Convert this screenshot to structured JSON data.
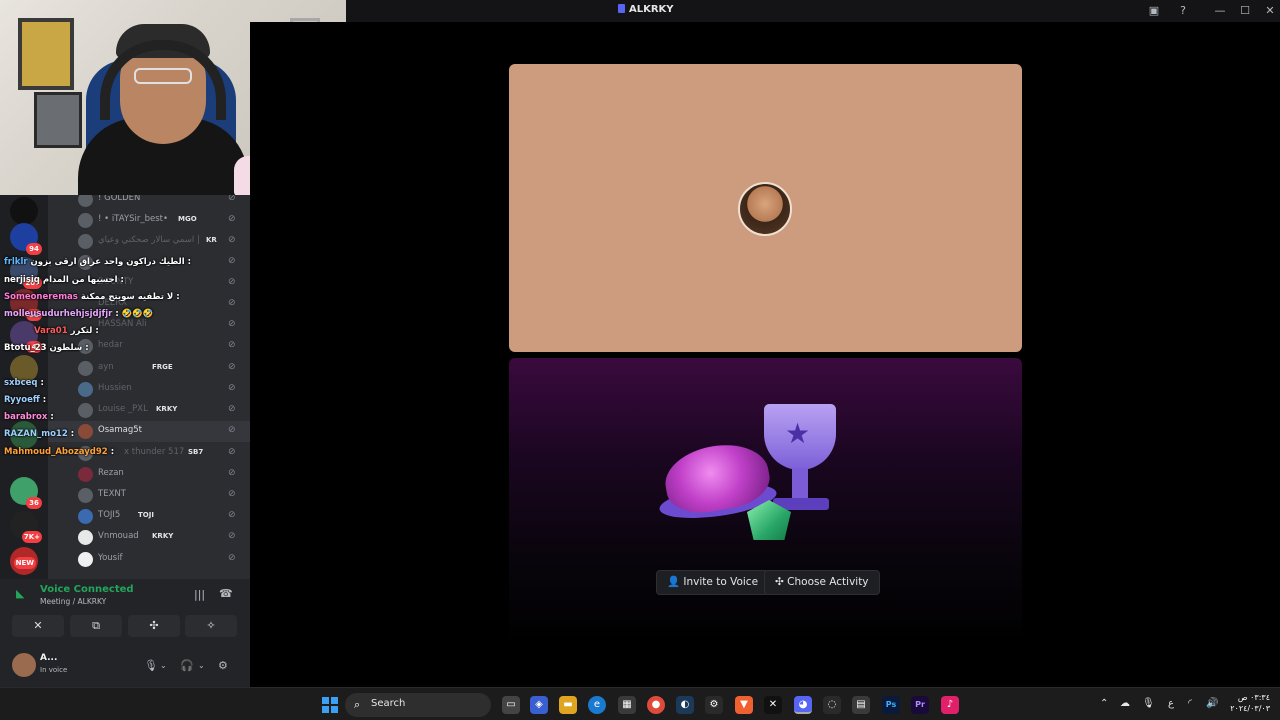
{
  "window": {
    "title": "ALKRKY"
  },
  "left_members": [
    {
      "name": "! GOLDEN",
      "tag": "",
      "dim": false
    },
    {
      "name": "! • iTAYSir_best•",
      "tag": "MGO",
      "dim": false
    },
    {
      "name": "اسمي سالار صحكني وعياي |",
      "tag": "KR",
      "dim": true
    },
    {
      "name": "",
      "tag": "",
      "dim": true
    },
    {
      "name": "BOUNTY",
      "tag": "",
      "dim": true
    },
    {
      "name": "DEERX",
      "tag": "",
      "dim": true
    },
    {
      "name": "HASSAN Ali",
      "tag": "",
      "dim": true
    },
    {
      "name": "hedar",
      "tag": "",
      "dim": true
    },
    {
      "name": "ayn",
      "tag": "FRGE",
      "dim": true
    },
    {
      "name": "Hussien",
      "tag": "",
      "dim": true
    },
    {
      "name": "Louise _PXL",
      "tag": "KRKY",
      "dim": true
    },
    {
      "name": "Osamag5t",
      "tag": "",
      "dim": false
    },
    {
      "name": "x thunder 517",
      "tag": "SB7",
      "dim": true
    },
    {
      "name": "Rezan",
      "tag": "",
      "dim": false
    },
    {
      "name": "TEXNT",
      "tag": "",
      "dim": false
    },
    {
      "name": "TOJI5",
      "tag": "TOJI",
      "dim": false
    },
    {
      "name": "Vnmouad",
      "tag": "KRKY",
      "dim": false
    },
    {
      "name": "Yousif",
      "tag": "",
      "dim": false
    }
  ],
  "chat": [
    {
      "user": "frlklr",
      "msg": "الطيك دراكون واحد عراق ارقى بزون :",
      "color": "#5fb8ff"
    },
    {
      "user": "nerjisiq",
      "msg": "احسبها من المدام :",
      "color": "#ffffff"
    },
    {
      "user": "Someoneremas",
      "msg": "لا تطفيه سويتج ممكنة :",
      "color": "#ff7ad9"
    },
    {
      "user": "molleusudurhehjsjdjfjr",
      "msg": ": 🤣🤣🤣",
      "color": "#e8a8ff"
    },
    {
      "user": "Vara01",
      "msg": "لتكرر :",
      "color": "#ff5a5a"
    },
    {
      "user": "Btotu_23",
      "msg": "سلطون :",
      "color": "#ffffff"
    },
    {
      "user": "sxbceq",
      "msg": ":",
      "color": "#9fd0ff"
    },
    {
      "user": "Ryyoeff",
      "msg": ":",
      "color": "#9fd0ff"
    },
    {
      "user": "barabrox",
      "msg": ":",
      "color": "#ff8ad8"
    },
    {
      "user": "RAZAN_mo12",
      "msg": ":",
      "color": "#9fd0ff"
    },
    {
      "user": "Mahmoud_Abozayd92",
      "msg": ":",
      "color": "#ffa23a"
    }
  ],
  "guild_badges": [
    "94",
    "207",
    "22",
    "4",
    "36",
    "7K+",
    "NEW"
  ],
  "voice": {
    "status": "Voice Connected",
    "channel": "Meeting / ALKRKY"
  },
  "user": {
    "name": "A...",
    "status": "In voice"
  },
  "activity": {
    "invite_label": "Invite to Voice",
    "choose_label": "Choose Activity"
  },
  "taskbar": {
    "search_label": "Search",
    "clock_time": "٠٣:٣٤ ص",
    "clock_date": "٢٠٢٤/٠٣/٠٣"
  },
  "colors": {
    "tile_bg": "#cd9c7e",
    "voice_connected": "#23a55a",
    "accent": "#5865f2"
  }
}
